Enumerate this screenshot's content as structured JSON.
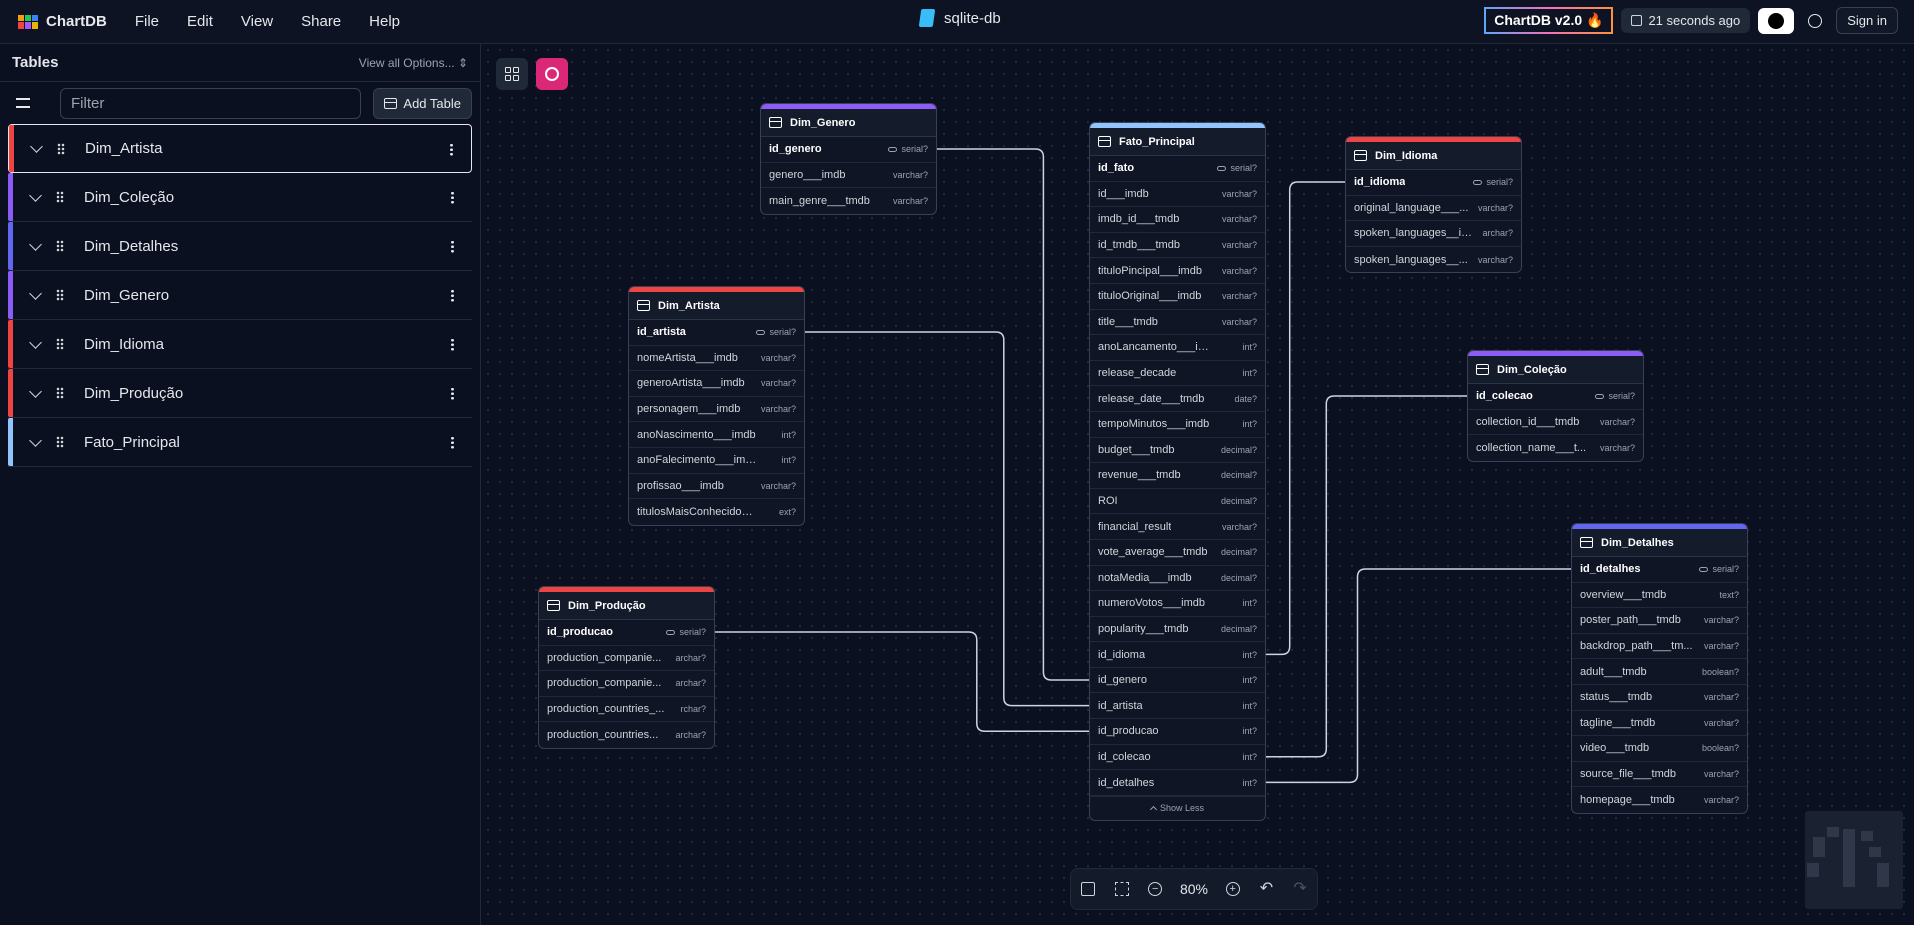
{
  "app": {
    "name": "ChartDB",
    "menu": [
      "File",
      "Edit",
      "View",
      "Share",
      "Help"
    ],
    "document_title": "sqlite-db",
    "version_badge": "ChartDB v2.0 🔥",
    "saved_status": "21 seconds ago",
    "sign_in": "Sign in",
    "colors": {
      "accent": "#db2777",
      "background": "#0b1020"
    }
  },
  "sidebar": {
    "title": "Tables",
    "view_all": "View all Options...",
    "filter_placeholder": "Filter",
    "add_table": "Add Table",
    "tables": [
      {
        "name": "Dim_Artista",
        "color": "#ef4444"
      },
      {
        "name": "Dim_Coleção",
        "color": "#8b5cf6"
      },
      {
        "name": "Dim_Detalhes",
        "color": "#6366f1"
      },
      {
        "name": "Dim_Genero",
        "color": "#8b5cf6"
      },
      {
        "name": "Dim_Idioma",
        "color": "#ef4444"
      },
      {
        "name": "Dim_Produção",
        "color": "#ef4444"
      },
      {
        "name": "Fato_Principal",
        "color": "#93c5fd"
      }
    ]
  },
  "canvas": {
    "zoom": "80%",
    "show_less": "Show Less",
    "tables": [
      {
        "id": "genero",
        "name": "Dim_Genero",
        "color": "#8b5cf6",
        "fields": [
          {
            "name": "id_genero",
            "type": "serial?",
            "pk": true
          },
          {
            "name": "genero___imdb",
            "type": "varchar?"
          },
          {
            "name": "main_genre___tmdb",
            "type": "varchar?"
          }
        ]
      },
      {
        "id": "artista",
        "name": "Dim_Artista",
        "color": "#ef4444",
        "fields": [
          {
            "name": "id_artista",
            "type": "serial?",
            "pk": true
          },
          {
            "name": "nomeArtista___imdb",
            "type": "varchar?"
          },
          {
            "name": "generoArtista___imdb",
            "type": "varchar?"
          },
          {
            "name": "personagem___imdb",
            "type": "varchar?"
          },
          {
            "name": "anoNascimento___imdb",
            "type": "int?"
          },
          {
            "name": "anoFalecimento___imdb",
            "type": "int?"
          },
          {
            "name": "profissao___imdb",
            "type": "varchar?"
          },
          {
            "name": "titulosMaisConhecidos_...",
            "type": "ext?"
          }
        ]
      },
      {
        "id": "producao",
        "name": "Dim_Produção",
        "color": "#ef4444",
        "fields": [
          {
            "name": "id_producao",
            "type": "serial?",
            "pk": true
          },
          {
            "name": "production_companie...",
            "type": "archar?"
          },
          {
            "name": "production_companie...",
            "type": "archar?"
          },
          {
            "name": "production_countries_...",
            "type": "rchar?"
          },
          {
            "name": "production_countries...",
            "type": "archar?"
          }
        ]
      },
      {
        "id": "fato",
        "name": "Fato_Principal",
        "color": "#93c5fd",
        "fields": [
          {
            "name": "id_fato",
            "type": "serial?",
            "pk": true
          },
          {
            "name": "id___imdb",
            "type": "varchar?"
          },
          {
            "name": "imdb_id___tmdb",
            "type": "varchar?"
          },
          {
            "name": "id_tmdb___tmdb",
            "type": "varchar?"
          },
          {
            "name": "tituloPincipal___imdb",
            "type": "varchar?"
          },
          {
            "name": "tituloOriginal___imdb",
            "type": "varchar?"
          },
          {
            "name": "title___tmdb",
            "type": "varchar?"
          },
          {
            "name": "anoLancamento___imdb",
            "type": "int?"
          },
          {
            "name": "release_decade",
            "type": "int?"
          },
          {
            "name": "release_date___tmdb",
            "type": "date?"
          },
          {
            "name": "tempoMinutos___imdb",
            "type": "int?"
          },
          {
            "name": "budget___tmdb",
            "type": "decimal?"
          },
          {
            "name": "revenue___tmdb",
            "type": "decimal?"
          },
          {
            "name": "ROI",
            "type": "decimal?"
          },
          {
            "name": "financial_result",
            "type": "varchar?"
          },
          {
            "name": "vote_average___tmdb",
            "type": "decimal?"
          },
          {
            "name": "notaMedia___imdb",
            "type": "decimal?"
          },
          {
            "name": "numeroVotos___imdb",
            "type": "int?"
          },
          {
            "name": "popularity___tmdb",
            "type": "decimal?"
          },
          {
            "name": "id_idioma",
            "type": "int?"
          },
          {
            "name": "id_genero",
            "type": "int?"
          },
          {
            "name": "id_artista",
            "type": "int?"
          },
          {
            "name": "id_producao",
            "type": "int?"
          },
          {
            "name": "id_colecao",
            "type": "int?"
          },
          {
            "name": "id_detalhes",
            "type": "int?"
          }
        ]
      },
      {
        "id": "idioma",
        "name": "Dim_Idioma",
        "color": "#ef4444",
        "fields": [
          {
            "name": "id_idioma",
            "type": "serial?",
            "pk": true
          },
          {
            "name": "original_language___...",
            "type": "varchar?"
          },
          {
            "name": "spoken_languages__is...",
            "type": "archar?"
          },
          {
            "name": "spoken_languages__...",
            "type": "varchar?"
          }
        ]
      },
      {
        "id": "colecao",
        "name": "Dim_Coleção",
        "color": "#8b5cf6",
        "fields": [
          {
            "name": "id_colecao",
            "type": "serial?",
            "pk": true
          },
          {
            "name": "collection_id___tmdb",
            "type": "varchar?"
          },
          {
            "name": "collection_name___t...",
            "type": "varchar?"
          }
        ]
      },
      {
        "id": "detalhes",
        "name": "Dim_Detalhes",
        "color": "#6366f1",
        "fields": [
          {
            "name": "id_detalhes",
            "type": "serial?",
            "pk": true
          },
          {
            "name": "overview___tmdb",
            "type": "text?"
          },
          {
            "name": "poster_path___tmdb",
            "type": "varchar?"
          },
          {
            "name": "backdrop_path___tm...",
            "type": "varchar?"
          },
          {
            "name": "adult___tmdb",
            "type": "boolean?"
          },
          {
            "name": "status___tmdb",
            "type": "varchar?"
          },
          {
            "name": "tagline___tmdb",
            "type": "varchar?"
          },
          {
            "name": "video___tmdb",
            "type": "boolean?"
          },
          {
            "name": "source_file___tmdb",
            "type": "varchar?"
          },
          {
            "name": "homepage___tmdb",
            "type": "varchar?"
          }
        ]
      }
    ]
  }
}
